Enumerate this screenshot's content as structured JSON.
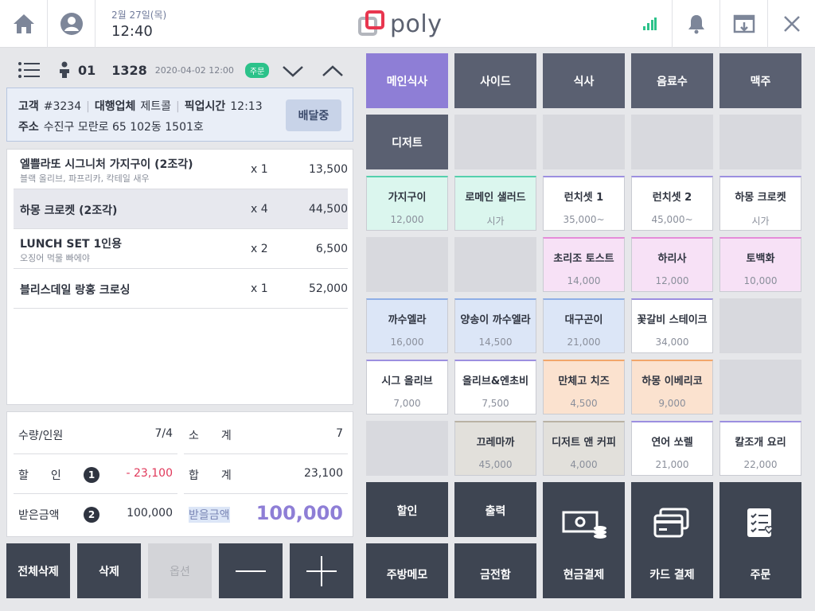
{
  "header": {
    "date": "2월 27일(목)",
    "time": "12:40",
    "logo_text": "poly",
    "home_icon": "home-icon",
    "user_icon": "user-icon",
    "signal_icon": "signal-icon",
    "bell_icon": "bell-icon",
    "window_icon": "window-icon",
    "close_icon": "close-icon"
  },
  "order": {
    "table_no": "01",
    "order_no": "1328",
    "datetime": "2020-04-02  12:00",
    "status_badge": "주문"
  },
  "customer": {
    "label_customer": "고객",
    "customer_no": "#3234",
    "label_agency": "대행업체",
    "agency": "제트콜",
    "label_pickup": "픽업시간",
    "pickup_time": "12:13",
    "label_address": "주소",
    "address": "수진구 모란로 65 102동 1501호",
    "status_button": "배달중"
  },
  "items": [
    {
      "name": "엘쁠라또 시그니처 가지구이 (2조각)",
      "sub": "블랙 올리브, 파프리카, 칵테일 새우",
      "qty": "x 1",
      "price": "13,500"
    },
    {
      "name": "하몽 크로켓 (2조각)",
      "sub": "",
      "qty": "x 4",
      "price": "44,500"
    },
    {
      "name": "LUNCH SET 1인용",
      "sub": "오징어 먹물 빠에야",
      "qty": "x 2",
      "price": "6,500"
    },
    {
      "name": "블리스데일 랑홍 크로싱",
      "sub": "",
      "qty": "x 1",
      "price": "52,000"
    }
  ],
  "summary": {
    "qty_label": "수량/인원",
    "qty_value": "7/4",
    "subtotal_label": "소　　계",
    "subtotal_value": "7",
    "discount_label": "할　　인",
    "discount_num": "1",
    "discount_value": "- 23,100",
    "total_label": "합　　계",
    "total_value": "23,100",
    "received_label": "받은금액",
    "received_num": "2",
    "received_value": "100,000",
    "to_receive_label": "받을금액",
    "to_receive_value": "100,000"
  },
  "actions": {
    "clear_all": "전체삭제",
    "delete": "삭제",
    "option": "옵션",
    "minus_icon": "minus-icon",
    "plus_icon": "plus-icon"
  },
  "categories": [
    "메인식사",
    "사이드",
    "식사",
    "음료수",
    "맥주",
    "디저트"
  ],
  "menu_items": [
    {
      "name": "가지구이",
      "price": "12,000"
    },
    {
      "name": "로메인 샐러드",
      "price": "시가"
    },
    {
      "name": "런치셋 1",
      "price": "35,000~"
    },
    {
      "name": "런치셋 2",
      "price": "45,000~"
    },
    {
      "name": "하몽 크로켓",
      "price": "시가"
    },
    {
      "name": "초리조 토스트",
      "price": "14,000"
    },
    {
      "name": "하리사",
      "price": "12,000"
    },
    {
      "name": "토백화",
      "price": "10,000"
    },
    {
      "name": "까수엘라",
      "price": "16,000"
    },
    {
      "name": "양송이 까수엘라",
      "price": "14,500"
    },
    {
      "name": "대구곤이",
      "price": "21,000"
    },
    {
      "name": "꽃갈비 스테이크",
      "price": "34,000"
    },
    {
      "name": "시그 올리브",
      "price": "7,000"
    },
    {
      "name": "올리브&엔초비",
      "price": "7,500"
    },
    {
      "name": "만체고 치즈",
      "price": "4,500"
    },
    {
      "name": "하몽 이베리코",
      "price": "9,000"
    },
    {
      "name": "끄레마까",
      "price": "45,000"
    },
    {
      "name": "디저트 앤 커피",
      "price": "4,000"
    },
    {
      "name": "연어 쏘렐",
      "price": "21,000"
    },
    {
      "name": "칼조개 요리",
      "price": "22,000"
    }
  ],
  "functions": {
    "discount": "할인",
    "print": "출력",
    "cash_pay": "현금결제",
    "card_pay": "카드 결제",
    "order": "주문",
    "kitchen_memo": "주방메모",
    "cash_drawer": "금전함"
  },
  "colors": {
    "accent": "#8e7ed6",
    "dark": "#3e4552",
    "badge_green": "#2cc28a",
    "discount_red": "#e0395b"
  }
}
